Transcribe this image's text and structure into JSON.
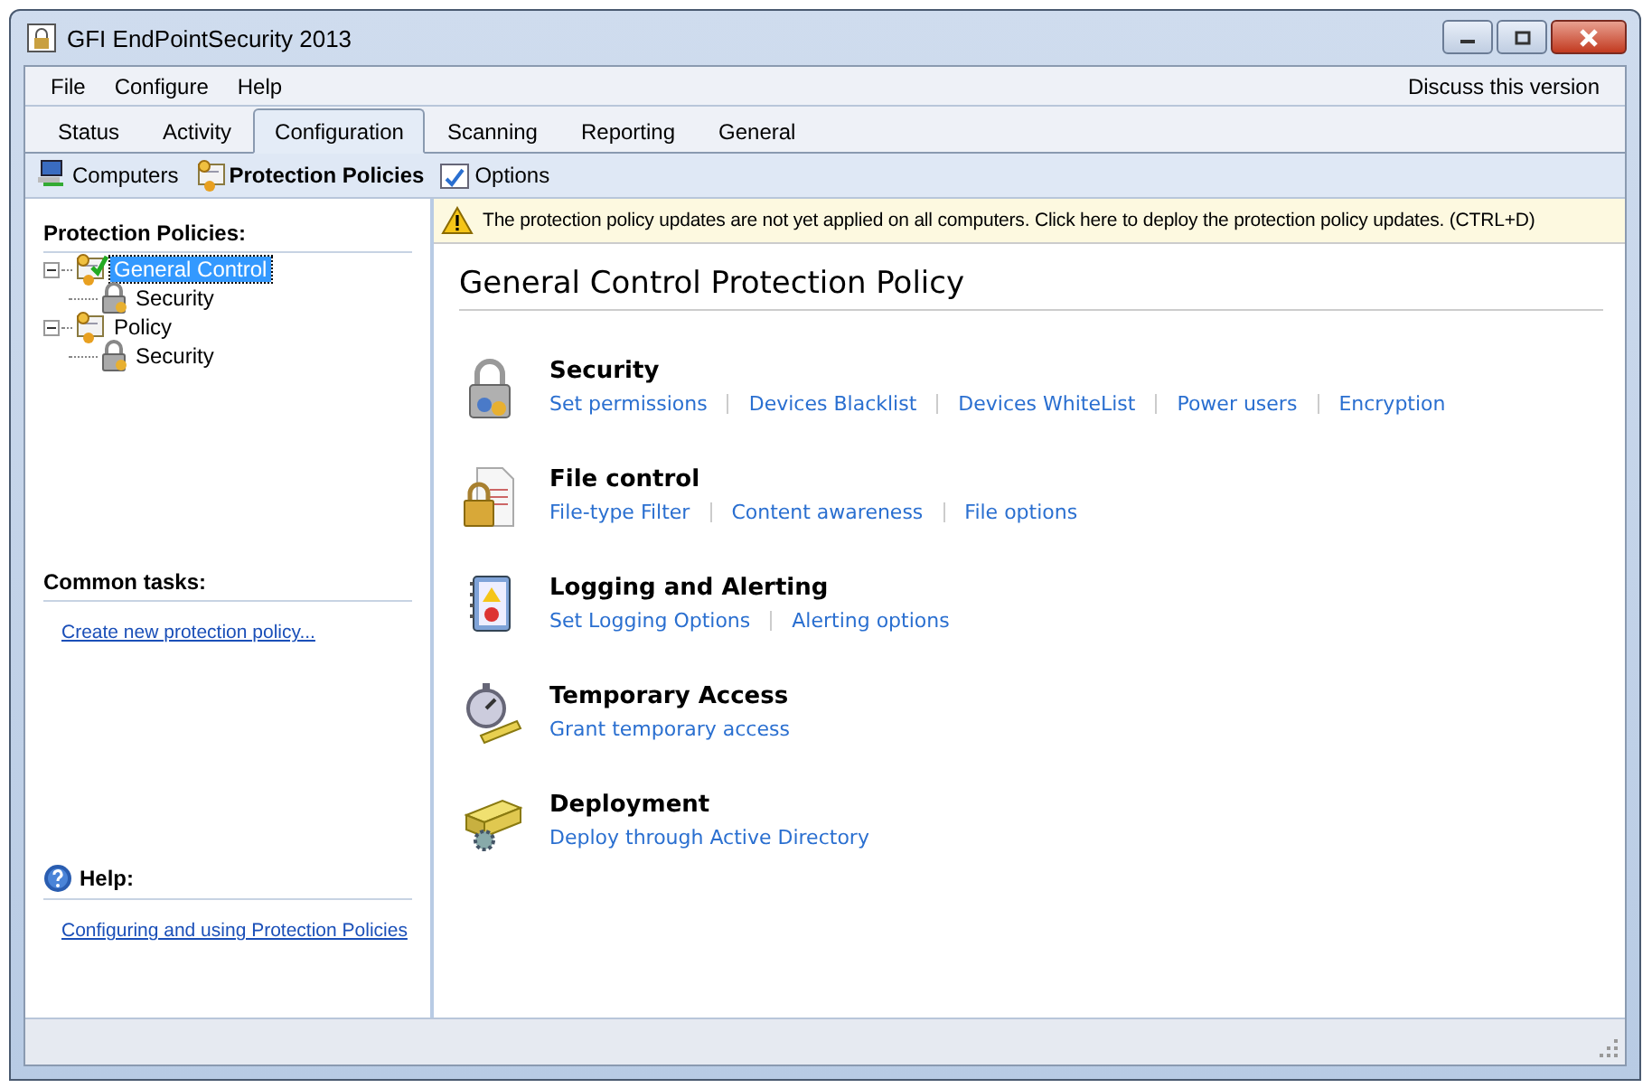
{
  "window": {
    "title": "GFI EndPointSecurity 2013"
  },
  "menu": [
    "File",
    "Configure",
    "Help"
  ],
  "menu_right": "Discuss this version",
  "tabs": [
    {
      "label": "Status",
      "selected": false
    },
    {
      "label": "Activity",
      "selected": false
    },
    {
      "label": "Configuration",
      "selected": true
    },
    {
      "label": "Scanning",
      "selected": false
    },
    {
      "label": "Reporting",
      "selected": false
    },
    {
      "label": "General",
      "selected": false
    }
  ],
  "toolbar": [
    {
      "label": "Computers",
      "kind": "computers",
      "selected": false
    },
    {
      "label": "Protection Policies",
      "kind": "policies",
      "selected": true
    },
    {
      "label": "Options",
      "kind": "options",
      "selected": false
    }
  ],
  "sidebar": {
    "tree_title": "Protection Policies:",
    "tree": [
      {
        "label": "General Control",
        "selected": true,
        "expanded": true,
        "checked": true,
        "children": [
          {
            "label": "Security",
            "selected": false
          }
        ]
      },
      {
        "label": "Policy",
        "selected": false,
        "expanded": true,
        "checked": false,
        "children": [
          {
            "label": "Security",
            "selected": false
          }
        ]
      }
    ],
    "tasks_title": "Common tasks:",
    "tasks": [
      "Create new protection policy..."
    ],
    "help_title": "Help:",
    "help_links": [
      "Configuring and using Protection Policies"
    ]
  },
  "notice": "The protection policy updates are not yet applied on all computers. Click here to deploy the protection policy updates. (CTRL+D)",
  "main": {
    "title": "General Control Protection Policy",
    "sections": [
      {
        "kind": "security",
        "title": "Security",
        "links": [
          "Set permissions",
          "Devices Blacklist",
          "Devices WhiteList",
          "Power users",
          "Encryption"
        ]
      },
      {
        "kind": "file",
        "title": "File control",
        "links": [
          "File-type Filter",
          "Content awareness",
          "File options"
        ]
      },
      {
        "kind": "logging",
        "title": "Logging and Alerting",
        "links": [
          "Set Logging Options",
          "Alerting options"
        ]
      },
      {
        "kind": "temporary",
        "title": "Temporary Access",
        "links": [
          "Grant temporary access"
        ]
      },
      {
        "kind": "deployment",
        "title": "Deployment",
        "links": [
          "Deploy through Active Directory"
        ]
      }
    ]
  }
}
